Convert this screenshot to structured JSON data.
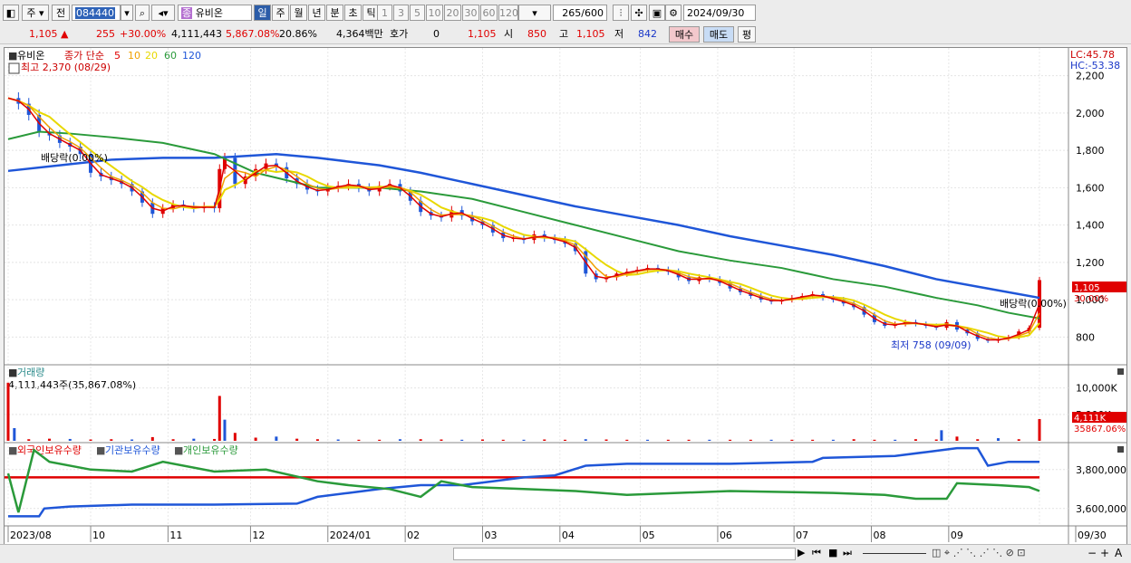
{
  "toolbar": {
    "market": "주",
    "prev": "전",
    "code": "084440",
    "stock_badge": "종",
    "stock_name": "유비온",
    "periods": [
      "일",
      "주",
      "월",
      "년",
      "분",
      "초",
      "틱"
    ],
    "intervals": [
      "1",
      "3",
      "5",
      "10",
      "20",
      "30",
      "60",
      "120"
    ],
    "count": "265",
    "count_total": "/600",
    "date": "2024/09/30"
  },
  "quote": {
    "price": "1,105",
    "arrow": "▲",
    "change": "255",
    "change_pct": "+30.00%",
    "volume": "4,111,443",
    "volume_pct": "5,867.08%",
    "turnover": "20.86%",
    "amount": "4,364백만",
    "bid_label": "호가",
    "bid_value": "0",
    "bid_price": "1,105",
    "open_label": "시",
    "open": "850",
    "high_label": "고",
    "high": "1,105",
    "low_label": "저",
    "low": "842",
    "buy": "매수",
    "sell": "매도",
    "avg": "평"
  },
  "chart_data": {
    "type": "line",
    "title": "유비온",
    "price_panel": {
      "legend": {
        "name": "유비온",
        "ma_label": "종가 단순",
        "periods": [
          "5",
          "10",
          "20",
          "60",
          "120"
        ]
      },
      "period_colors": [
        "#e00000",
        "#f0a000",
        "#e8d800",
        "#2a9a3a",
        "#1f56d8"
      ],
      "ylim": [
        700,
        2300
      ],
      "yticks": [
        "2,200",
        "2,000",
        "1,800",
        "1,600",
        "1,400",
        "1,200",
        "1,000",
        "800"
      ],
      "ytick_values": [
        2200,
        2000,
        1800,
        1600,
        1400,
        1200,
        1000,
        800
      ],
      "lc": "LC:45.78",
      "hc": "HC:-53.38",
      "high_note": "최고 2,370 (08/29)",
      "low_note": "최저 758 (09/09)",
      "dividend_note_left": "배당락(0.00%)",
      "dividend_note_right": "배당락(0.00%)",
      "last_price": "1,105",
      "last_pct": "30.00%",
      "x_months": [
        "2023/08",
        "10",
        "11",
        "12",
        "2024/01",
        "02",
        "03",
        "04",
        "05",
        "06",
        "07",
        "08",
        "09",
        "09/30"
      ],
      "x_month_positions": [
        0.0,
        0.08,
        0.155,
        0.235,
        0.31,
        0.385,
        0.46,
        0.535,
        0.613,
        0.688,
        0.762,
        0.837,
        0.912,
        1.0
      ],
      "price_series": [
        [
          0.0,
          2080
        ],
        [
          0.01,
          2050
        ],
        [
          0.02,
          1990
        ],
        [
          0.03,
          1900
        ],
        [
          0.04,
          1880
        ],
        [
          0.05,
          1840
        ],
        [
          0.06,
          1820
        ],
        [
          0.07,
          1780
        ],
        [
          0.08,
          1680
        ],
        [
          0.09,
          1660
        ],
        [
          0.1,
          1640
        ],
        [
          0.11,
          1620
        ],
        [
          0.12,
          1580
        ],
        [
          0.13,
          1520
        ],
        [
          0.14,
          1460
        ],
        [
          0.15,
          1490
        ],
        [
          0.16,
          1510
        ],
        [
          0.17,
          1500
        ],
        [
          0.18,
          1490
        ],
        [
          0.19,
          1500
        ],
        [
          0.2,
          1490
        ],
        [
          0.205,
          1700
        ],
        [
          0.21,
          1760
        ],
        [
          0.22,
          1620
        ],
        [
          0.23,
          1660
        ],
        [
          0.24,
          1700
        ],
        [
          0.25,
          1730
        ],
        [
          0.26,
          1710
        ],
        [
          0.27,
          1650
        ],
        [
          0.28,
          1620
        ],
        [
          0.29,
          1590
        ],
        [
          0.3,
          1580
        ],
        [
          0.31,
          1600
        ],
        [
          0.32,
          1610
        ],
        [
          0.33,
          1620
        ],
        [
          0.34,
          1600
        ],
        [
          0.35,
          1580
        ],
        [
          0.36,
          1610
        ],
        [
          0.37,
          1620
        ],
        [
          0.38,
          1580
        ],
        [
          0.39,
          1530
        ],
        [
          0.4,
          1470
        ],
        [
          0.41,
          1450
        ],
        [
          0.42,
          1440
        ],
        [
          0.43,
          1480
        ],
        [
          0.44,
          1450
        ],
        [
          0.45,
          1420
        ],
        [
          0.46,
          1400
        ],
        [
          0.47,
          1360
        ],
        [
          0.48,
          1330
        ],
        [
          0.49,
          1330
        ],
        [
          0.5,
          1320
        ],
        [
          0.51,
          1350
        ],
        [
          0.52,
          1330
        ],
        [
          0.53,
          1320
        ],
        [
          0.54,
          1300
        ],
        [
          0.55,
          1260
        ],
        [
          0.56,
          1140
        ],
        [
          0.57,
          1110
        ],
        [
          0.58,
          1120
        ],
        [
          0.59,
          1140
        ],
        [
          0.6,
          1150
        ],
        [
          0.61,
          1160
        ],
        [
          0.62,
          1170
        ],
        [
          0.63,
          1160
        ],
        [
          0.64,
          1150
        ],
        [
          0.65,
          1120
        ],
        [
          0.66,
          1100
        ],
        [
          0.67,
          1120
        ],
        [
          0.68,
          1110
        ],
        [
          0.69,
          1090
        ],
        [
          0.7,
          1060
        ],
        [
          0.71,
          1040
        ],
        [
          0.72,
          1020
        ],
        [
          0.73,
          1000
        ],
        [
          0.74,
          990
        ],
        [
          0.75,
          1000
        ],
        [
          0.76,
          1010
        ],
        [
          0.77,
          1020
        ],
        [
          0.78,
          1030
        ],
        [
          0.79,
          1010
        ],
        [
          0.8,
          1000
        ],
        [
          0.81,
          980
        ],
        [
          0.82,
          960
        ],
        [
          0.83,
          920
        ],
        [
          0.84,
          880
        ],
        [
          0.85,
          860
        ],
        [
          0.86,
          870
        ],
        [
          0.87,
          880
        ],
        [
          0.88,
          870
        ],
        [
          0.89,
          860
        ],
        [
          0.9,
          850
        ],
        [
          0.91,
          880
        ],
        [
          0.92,
          840
        ],
        [
          0.93,
          820
        ],
        [
          0.94,
          790
        ],
        [
          0.95,
          780
        ],
        [
          0.96,
          790
        ],
        [
          0.97,
          800
        ],
        [
          0.98,
          830
        ],
        [
          0.99,
          850
        ],
        [
          1.0,
          1105
        ]
      ],
      "ma60_series": [
        [
          0.0,
          1860
        ],
        [
          0.03,
          1900
        ],
        [
          0.06,
          1890
        ],
        [
          0.1,
          1870
        ],
        [
          0.15,
          1840
        ],
        [
          0.2,
          1780
        ],
        [
          0.24,
          1680
        ],
        [
          0.3,
          1600
        ],
        [
          0.36,
          1600
        ],
        [
          0.4,
          1580
        ],
        [
          0.45,
          1540
        ],
        [
          0.5,
          1470
        ],
        [
          0.55,
          1400
        ],
        [
          0.6,
          1330
        ],
        [
          0.65,
          1260
        ],
        [
          0.7,
          1210
        ],
        [
          0.75,
          1170
        ],
        [
          0.8,
          1110
        ],
        [
          0.85,
          1070
        ],
        [
          0.9,
          1010
        ],
        [
          0.94,
          970
        ],
        [
          0.97,
          930
        ],
        [
          1.0,
          900
        ]
      ],
      "ma120_series": [
        [
          0.0,
          1690
        ],
        [
          0.05,
          1720
        ],
        [
          0.1,
          1750
        ],
        [
          0.15,
          1760
        ],
        [
          0.2,
          1760
        ],
        [
          0.26,
          1780
        ],
        [
          0.3,
          1760
        ],
        [
          0.36,
          1720
        ],
        [
          0.4,
          1680
        ],
        [
          0.45,
          1620
        ],
        [
          0.5,
          1560
        ],
        [
          0.55,
          1500
        ],
        [
          0.6,
          1450
        ],
        [
          0.65,
          1400
        ],
        [
          0.7,
          1340
        ],
        [
          0.75,
          1290
        ],
        [
          0.8,
          1240
        ],
        [
          0.85,
          1180
        ],
        [
          0.9,
          1110
        ],
        [
          0.95,
          1060
        ],
        [
          1.0,
          1010
        ]
      ]
    },
    "volume_panel": {
      "label": "거래량",
      "last_note": "4,111,443주(35,867.08%)",
      "yticks": [
        "10,000K",
        "5,000K"
      ],
      "last_value": "4,111K",
      "last_pct": "35867.06%",
      "ylim": [
        0,
        12000
      ],
      "bars": [
        [
          0.0,
          11000
        ],
        [
          0.006,
          2400
        ],
        [
          0.02,
          300
        ],
        [
          0.04,
          400
        ],
        [
          0.06,
          350
        ],
        [
          0.08,
          250
        ],
        [
          0.1,
          300
        ],
        [
          0.12,
          250
        ],
        [
          0.14,
          700
        ],
        [
          0.16,
          300
        ],
        [
          0.18,
          400
        ],
        [
          0.2,
          350
        ],
        [
          0.205,
          8500
        ],
        [
          0.21,
          4000
        ],
        [
          0.22,
          1500
        ],
        [
          0.24,
          600
        ],
        [
          0.26,
          800
        ],
        [
          0.28,
          400
        ],
        [
          0.3,
          300
        ],
        [
          0.32,
          250
        ],
        [
          0.34,
          200
        ],
        [
          0.36,
          200
        ],
        [
          0.38,
          300
        ],
        [
          0.4,
          300
        ],
        [
          0.42,
          250
        ],
        [
          0.44,
          200
        ],
        [
          0.46,
          250
        ],
        [
          0.48,
          200
        ],
        [
          0.5,
          200
        ],
        [
          0.52,
          250
        ],
        [
          0.54,
          200
        ],
        [
          0.56,
          300
        ],
        [
          0.58,
          250
        ],
        [
          0.6,
          200
        ],
        [
          0.62,
          200
        ],
        [
          0.64,
          200
        ],
        [
          0.66,
          200
        ],
        [
          0.68,
          200
        ],
        [
          0.7,
          200
        ],
        [
          0.72,
          200
        ],
        [
          0.74,
          200
        ],
        [
          0.76,
          200
        ],
        [
          0.78,
          200
        ],
        [
          0.8,
          200
        ],
        [
          0.82,
          300
        ],
        [
          0.84,
          200
        ],
        [
          0.86,
          200
        ],
        [
          0.88,
          300
        ],
        [
          0.9,
          250
        ],
        [
          0.905,
          2000
        ],
        [
          0.92,
          800
        ],
        [
          0.94,
          300
        ],
        [
          0.96,
          500
        ],
        [
          0.98,
          300
        ],
        [
          1.0,
          4111
        ]
      ]
    },
    "holdings_panel": {
      "legend": [
        "외국인보유수량",
        "기관보유수량",
        "개인보유수량"
      ],
      "legend_colors": [
        "#e00000",
        "#1f56d8",
        "#2a9a3a"
      ],
      "yticks": [
        "3,800,000",
        "3,600,000"
      ],
      "ylim": [
        3520000,
        3920000
      ],
      "foreign_level": 3760000,
      "institution_series": [
        [
          0.0,
          3560000
        ],
        [
          0.03,
          3560000
        ],
        [
          0.035,
          3600000
        ],
        [
          0.06,
          3610000
        ],
        [
          0.12,
          3620000
        ],
        [
          0.2,
          3620000
        ],
        [
          0.28,
          3625000
        ],
        [
          0.3,
          3660000
        ],
        [
          0.33,
          3680000
        ],
        [
          0.36,
          3700000
        ],
        [
          0.4,
          3720000
        ],
        [
          0.44,
          3720000
        ],
        [
          0.47,
          3740000
        ],
        [
          0.5,
          3760000
        ],
        [
          0.53,
          3770000
        ],
        [
          0.56,
          3820000
        ],
        [
          0.6,
          3830000
        ],
        [
          0.7,
          3830000
        ],
        [
          0.78,
          3840000
        ],
        [
          0.79,
          3860000
        ],
        [
          0.86,
          3870000
        ],
        [
          0.89,
          3890000
        ],
        [
          0.92,
          3910000
        ],
        [
          0.94,
          3910000
        ],
        [
          0.95,
          3820000
        ],
        [
          0.97,
          3840000
        ],
        [
          1.0,
          3840000
        ]
      ],
      "individual_series": [
        [
          0.0,
          3780000
        ],
        [
          0.01,
          3580000
        ],
        [
          0.025,
          3900000
        ],
        [
          0.04,
          3840000
        ],
        [
          0.08,
          3800000
        ],
        [
          0.12,
          3790000
        ],
        [
          0.15,
          3840000
        ],
        [
          0.2,
          3790000
        ],
        [
          0.25,
          3800000
        ],
        [
          0.3,
          3740000
        ],
        [
          0.33,
          3720000
        ],
        [
          0.37,
          3700000
        ],
        [
          0.4,
          3660000
        ],
        [
          0.42,
          3740000
        ],
        [
          0.45,
          3710000
        ],
        [
          0.5,
          3700000
        ],
        [
          0.55,
          3690000
        ],
        [
          0.6,
          3670000
        ],
        [
          0.7,
          3690000
        ],
        [
          0.8,
          3680000
        ],
        [
          0.85,
          3670000
        ],
        [
          0.88,
          3650000
        ],
        [
          0.91,
          3650000
        ],
        [
          0.92,
          3730000
        ],
        [
          0.96,
          3720000
        ],
        [
          0.99,
          3710000
        ],
        [
          1.0,
          3690000
        ]
      ]
    }
  },
  "bottom": {
    "nav": [
      "▶",
      "⏮",
      "■",
      "⏭"
    ],
    "zoom": [
      "−",
      "+",
      "A"
    ]
  }
}
